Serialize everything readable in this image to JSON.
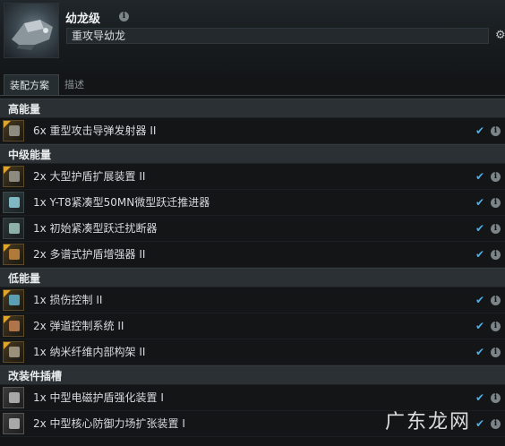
{
  "header": {
    "ship_name": "幼龙级",
    "fitting_name": "重攻导幼龙",
    "info_icon": "info-icon",
    "settings_icon": "gear-icon"
  },
  "tabs": [
    {
      "label": "装配方案",
      "active": true
    },
    {
      "label": "描述",
      "active": false
    }
  ],
  "sections": [
    {
      "title": "高能量",
      "items": [
        {
          "label": "6x 重型攻击导弹发射器 II",
          "checked": true
        }
      ]
    },
    {
      "title": "中级能量",
      "items": [
        {
          "label": "2x 大型护盾扩展装置 II",
          "checked": true
        },
        {
          "label": "1x Y-T8紧凑型50MN微型跃迁推进器",
          "checked": true
        },
        {
          "label": "1x 初始紧凑型跃迁扰断器",
          "checked": true
        },
        {
          "label": "2x 多谱式护盾增强器 II",
          "checked": true
        }
      ]
    },
    {
      "title": "低能量",
      "items": [
        {
          "label": "1x 损伤控制 II",
          "checked": true
        },
        {
          "label": "2x 弹道控制系统 II",
          "checked": true
        },
        {
          "label": "1x 纳米纤维内部构架 II",
          "checked": true
        }
      ]
    },
    {
      "title": "改装件插槽",
      "items": [
        {
          "label": "1x 中型电磁护盾强化装置 I",
          "checked": true
        },
        {
          "label": "2x 中型核心防御力场扩张装置 I",
          "checked": true
        }
      ]
    }
  ],
  "watermark": "广东龙网",
  "colors": {
    "accent_check": "#4eb0e8",
    "module_corner": "#e0a42c",
    "section_bg": "#2a3033"
  }
}
